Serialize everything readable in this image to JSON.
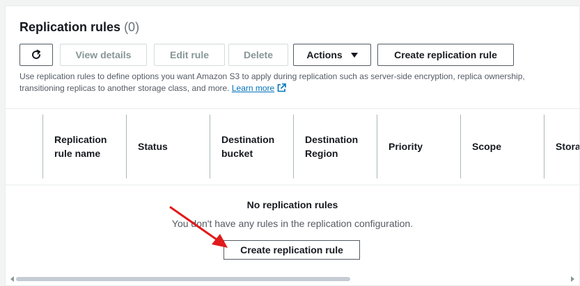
{
  "header": {
    "title": "Replication rules",
    "count": "(0)"
  },
  "toolbar": {
    "refresh_icon": "refresh-icon",
    "view_details": "View details",
    "edit_rule": "Edit rule",
    "delete": "Delete",
    "actions": "Actions",
    "create": "Create replication rule"
  },
  "description": {
    "text": "Use replication rules to define options you want Amazon S3 to apply during replication such as server-side encryption, replica ownership, transitioning replicas to another storage class, and more.",
    "link": "Learn more"
  },
  "table": {
    "columns": [
      "Replication rule name",
      "Status",
      "Destination bucket",
      "Destination Region",
      "Priority",
      "Scope",
      "Stora"
    ]
  },
  "empty": {
    "title": "No replication rules",
    "message": "You don't have any rules in the replication configuration.",
    "button": "Create replication rule"
  },
  "colors": {
    "link": "#0073bb",
    "arrow": "#e21a1a"
  }
}
